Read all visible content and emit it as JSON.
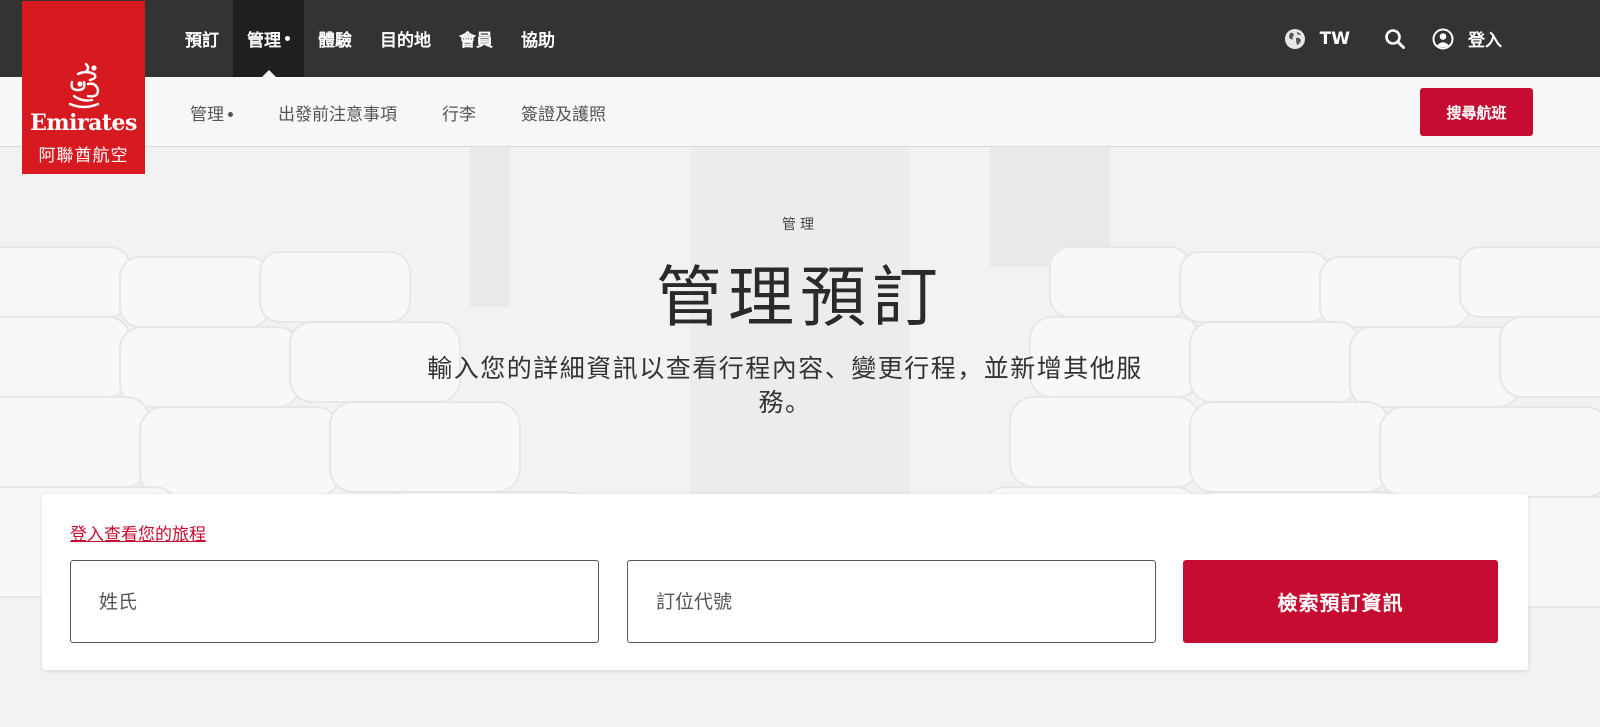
{
  "brand": {
    "name_en": "Emirates",
    "name_zh": "阿聯酋航空",
    "color": "#d71920"
  },
  "primary_nav": {
    "items": [
      {
        "label": "預訂",
        "active": false
      },
      {
        "label": "管理",
        "active": true
      },
      {
        "label": "體驗",
        "active": false
      },
      {
        "label": "目的地",
        "active": false
      },
      {
        "label": "會員",
        "active": false
      },
      {
        "label": "協助",
        "active": false
      }
    ]
  },
  "utility": {
    "language_icon": "globe-icon",
    "language": "TW",
    "search_icon": "search-icon",
    "user_icon": "user-circle-icon",
    "login_label": "登入"
  },
  "sub_nav": {
    "items": [
      {
        "label": "管理",
        "has_dot": true
      },
      {
        "label": "出發前注意事項",
        "has_dot": false
      },
      {
        "label": "行李",
        "has_dot": false
      },
      {
        "label": "簽證及護照",
        "has_dot": false
      }
    ],
    "search_flights_label": "搜尋航班"
  },
  "hero": {
    "eyebrow": "管理",
    "title": "管理預訂",
    "description": "輸入您的詳細資訊以查看行程內容、變更行程，並新增其他服務。"
  },
  "booking_form": {
    "login_link": "登入查看您的旅程",
    "last_name_placeholder": "姓氏",
    "booking_ref_placeholder": "訂位代號",
    "submit_label": "檢索預訂資訊",
    "accent_color": "#c60c30"
  }
}
